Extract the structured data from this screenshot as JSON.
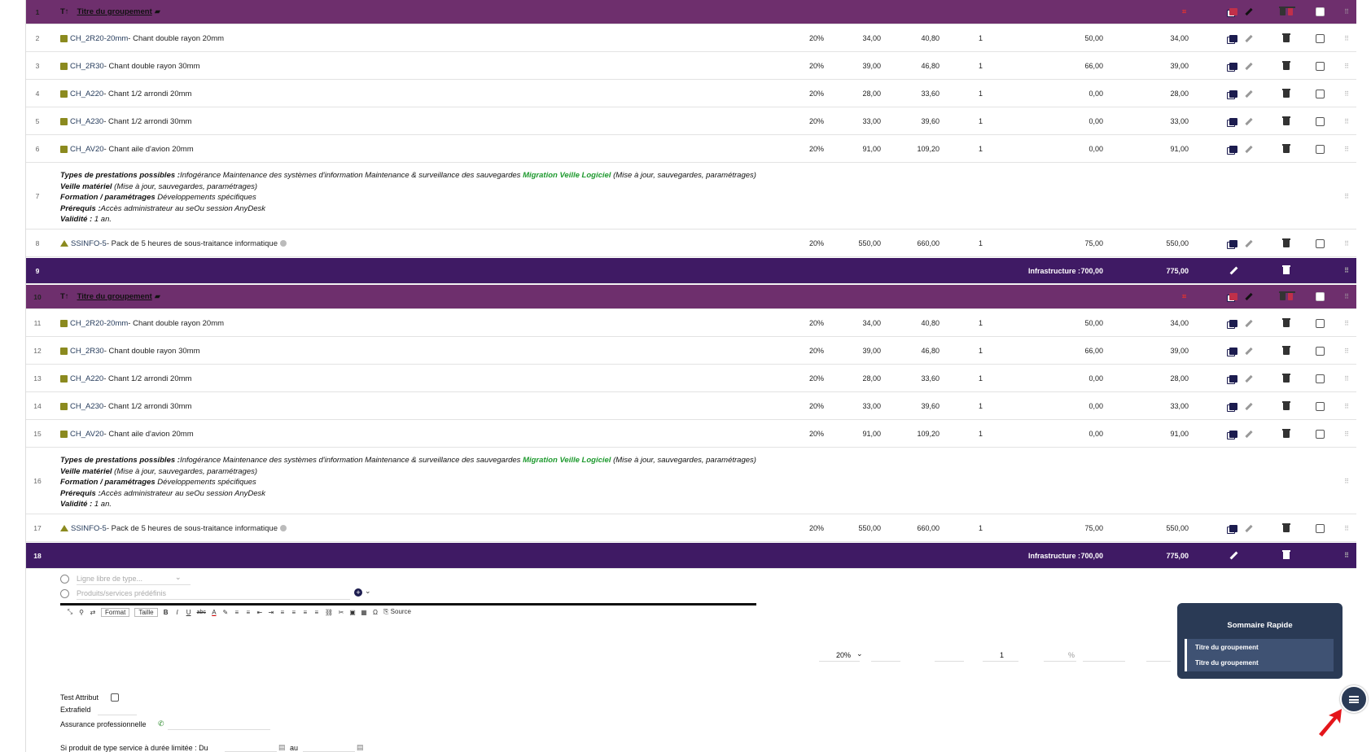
{
  "rows": [
    {
      "type": "group",
      "num": "1",
      "title": "Titre du groupement"
    },
    {
      "type": "prod",
      "num": "2",
      "ref": "CH_2R20-20mm",
      "label": " - Chant double rayon 20mm",
      "vat": "20%",
      "pu": "34,00",
      "put": "40,80",
      "qty": "1",
      "red": "50,00",
      "tot": "34,00"
    },
    {
      "type": "prod",
      "num": "3",
      "ref": "CH_2R30",
      "label": " - Chant double rayon 30mm",
      "vat": "20%",
      "pu": "39,00",
      "put": "46,80",
      "qty": "1",
      "red": "66,00",
      "tot": "39,00"
    },
    {
      "type": "prod",
      "num": "4",
      "ref": "CH_A220",
      "label": " - Chant 1/2 arrondi 20mm",
      "vat": "20%",
      "pu": "28,00",
      "put": "33,60",
      "qty": "1",
      "red": "0,00",
      "tot": "28,00"
    },
    {
      "type": "prod",
      "num": "5",
      "ref": "CH_A230",
      "label": " - Chant 1/2 arrondi 30mm",
      "vat": "20%",
      "pu": "33,00",
      "put": "39,60",
      "qty": "1",
      "red": "0,00",
      "tot": "33,00"
    },
    {
      "type": "prod",
      "num": "6",
      "ref": "CH_AV20",
      "label": " - Chant aile d'avion 20mm",
      "vat": "20%",
      "pu": "91,00",
      "put": "109,20",
      "qty": "1",
      "red": "0,00",
      "tot": "91,00"
    },
    {
      "type": "desc",
      "num": "7"
    },
    {
      "type": "service",
      "num": "8",
      "ref": "SSINFO-5",
      "label": " - Pack de 5 heures de sous-traitance informatique",
      "vat": "20%",
      "pu": "550,00",
      "put": "660,00",
      "qty": "1",
      "red": "75,00",
      "tot": "550,00"
    },
    {
      "type": "total",
      "num": "9",
      "label": "Infrastructure :",
      "pu": "700,00",
      "tot": "775,00"
    },
    {
      "type": "group",
      "num": "10",
      "title": "Titre du groupement"
    },
    {
      "type": "prod",
      "num": "11",
      "ref": "CH_2R20-20mm",
      "label": " - Chant double rayon 20mm",
      "vat": "20%",
      "pu": "34,00",
      "put": "40,80",
      "qty": "1",
      "red": "50,00",
      "tot": "34,00"
    },
    {
      "type": "prod",
      "num": "12",
      "ref": "CH_2R30",
      "label": " - Chant double rayon 30mm",
      "vat": "20%",
      "pu": "39,00",
      "put": "46,80",
      "qty": "1",
      "red": "66,00",
      "tot": "39,00"
    },
    {
      "type": "prod",
      "num": "13",
      "ref": "CH_A220",
      "label": " - Chant 1/2 arrondi 20mm",
      "vat": "20%",
      "pu": "28,00",
      "put": "33,60",
      "qty": "1",
      "red": "0,00",
      "tot": "28,00"
    },
    {
      "type": "prod",
      "num": "14",
      "ref": "CH_A230",
      "label": " - Chant 1/2 arrondi 30mm",
      "vat": "20%",
      "pu": "33,00",
      "put": "39,60",
      "qty": "1",
      "red": "0,00",
      "tot": "33,00"
    },
    {
      "type": "prod",
      "num": "15",
      "ref": "CH_AV20",
      "label": " - Chant aile d'avion 20mm",
      "vat": "20%",
      "pu": "91,00",
      "put": "109,20",
      "qty": "1",
      "red": "0,00",
      "tot": "91,00"
    },
    {
      "type": "desc",
      "num": "16"
    },
    {
      "type": "service",
      "num": "17",
      "ref": "SSINFO-5",
      "label": " - Pack de 5 heures de sous-traitance informatique",
      "vat": "20%",
      "pu": "550,00",
      "put": "660,00",
      "qty": "1",
      "red": "75,00",
      "tot": "550,00"
    },
    {
      "type": "total",
      "num": "18",
      "label": "Infrastructure :",
      "pu": "700,00",
      "tot": "775,00"
    }
  ],
  "desc": {
    "l1a": "Types de prestations possibles :",
    "l1b": "Infogérance Maintenance des systèmes d'information Maintenance & surveillance des sauvegardes ",
    "l1c": "Migration Veille Logiciel",
    "l1d": " (Mise à jour, sauvegardes, paramétrages)",
    "l2a": "Veille matériel",
    "l2b": " (Mise à jour, sauvegardes, paramétrages)",
    "l3a": "Formation / paramétrages",
    "l3b": " Développements spécifiques",
    "l4a": "Prérequis :",
    "l4b": "Accès administrateur au seOu session AnyDesk",
    "l5a": "Validité :",
    "l5b": " 1 an."
  },
  "form": {
    "line_type_ph": "Ligne libre de type...",
    "products_ph": "Produits/services prédéfinis",
    "toolbar": {
      "format": "Format",
      "size": "Taille",
      "bold": "B",
      "italic": "I",
      "underline": "U",
      "strike": "abc",
      "source": "Source"
    },
    "vat": "20%",
    "qty": "1",
    "pct": "%",
    "test_attribut": "Test Attribut",
    "extrafield": "Extrafield",
    "assurance": "Assurance professionnelle",
    "duration": "Si produit de type service à durée limitée : Du",
    "au": "au"
  },
  "sommaire": {
    "title": "Sommaire Rapide",
    "items": [
      "Titre du groupement",
      "Titre du groupement"
    ]
  },
  "colors": {
    "group": "#6e2f6d",
    "total": "#3f1a64",
    "panel": "#2a3a55",
    "green": "#1f9a2f"
  }
}
